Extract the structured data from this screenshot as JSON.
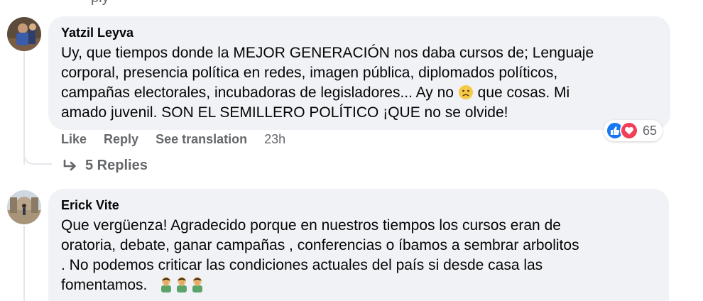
{
  "top_fragment": "ply",
  "comments": [
    {
      "author": "Yatzil Leyva",
      "text_lines": [
        "Uy, que tiempos donde la MEJOR GENERACIÓN nos daba cursos de; Lenguaje",
        "corporal, presencia política en redes, imagen pública, diplomados políticos,",
        "campañas electorales, incubadoras de legisladores... Ay no",
        "que cosas. Mi",
        "amado juvenil. SON EL SEMILLERO POLÍTICO ¡QUE no se olvide!"
      ],
      "inline_emoji": "sad-face-emoji",
      "actions": {
        "like": "Like",
        "reply": "Reply",
        "translate": "See translation",
        "time": "23h"
      },
      "reactions": {
        "icons": [
          "like-icon",
          "love-icon"
        ],
        "count": "65",
        "colors": {
          "like": "#1877f2",
          "love": "#f33e58"
        }
      },
      "replies_label": "5 Replies"
    },
    {
      "author": "Erick Vite",
      "text_lines": [
        "Que vergüenza! Agradecido porque en nuestros tiempos los cursos eran de",
        "oratoria, debate, ganar campañas , conferencias o íbamos a sembrar arbolitos",
        ". No podemos criticar las condiciones actuales del país si desde casa las",
        "fomentamos."
      ],
      "trailing_emojis": [
        "facepalm-man-emoji",
        "facepalm-man-emoji",
        "facepalm-man-emoji"
      ]
    }
  ],
  "colors": {
    "bubble": "#f0f2f5",
    "secondary_text": "#65676b",
    "primary_text": "#050505"
  }
}
